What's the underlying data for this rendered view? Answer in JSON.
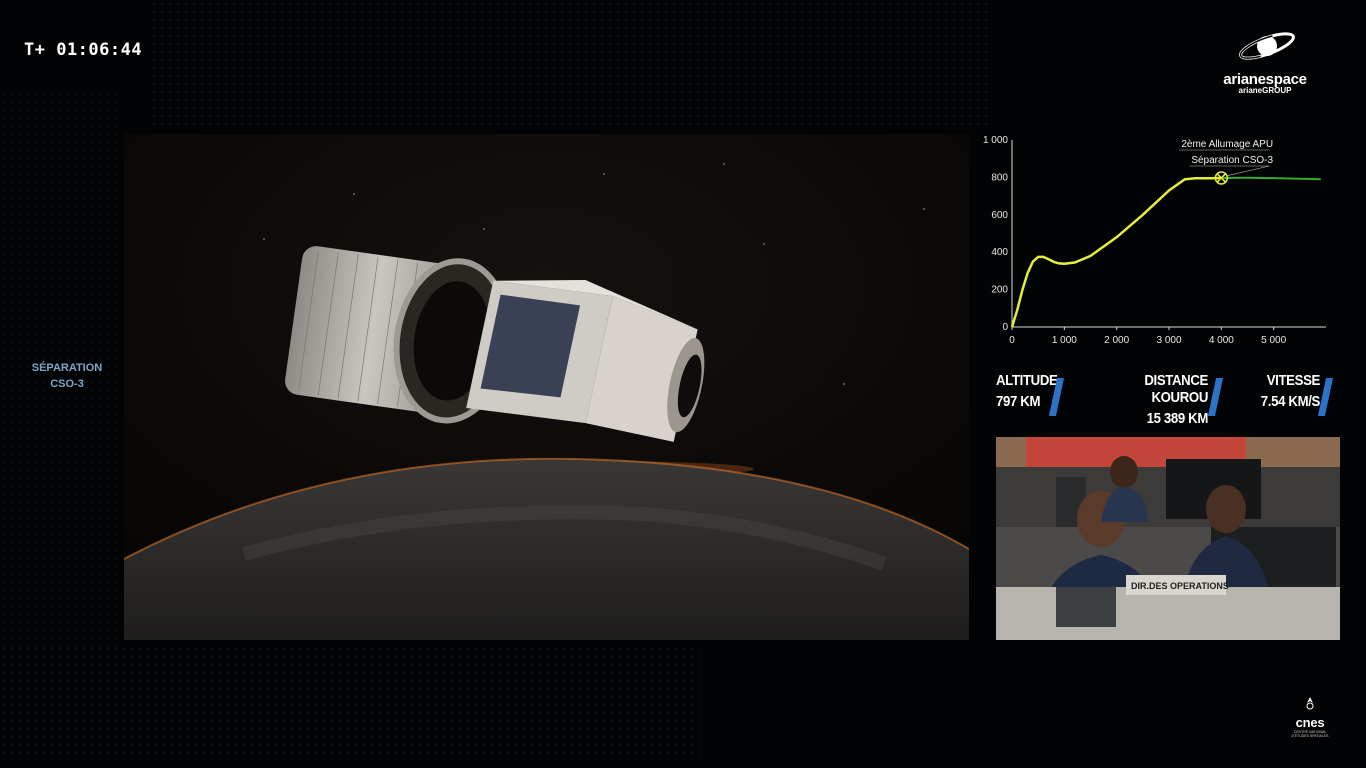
{
  "overlay": {
    "timer": "T+ 01:06:44",
    "phase_line1": "SÉPARATION",
    "phase_line2": "CSO-3"
  },
  "brand": {
    "name": "arianespace",
    "sub": "arianeGROUP",
    "cnes": "cnes",
    "cnes_sub": "CENTRE NATIONAL D'ÉTUDES SPATIALES"
  },
  "telemetry": {
    "altitude_label": "ALTITUDE",
    "altitude_value": "797 KM",
    "distance_label": "DISTANCE KOUROU",
    "distance_value": "15 389 KM",
    "speed_label": "VITESSE",
    "speed_value": "7.54 KM/S",
    "accent": "#2a73c7"
  },
  "chart_data": {
    "type": "line",
    "title": "",
    "xlabel": "",
    "ylabel": "",
    "xlim": [
      0,
      6000
    ],
    "ylim": [
      0,
      1000
    ],
    "x_ticks": [
      "0",
      "1 000",
      "2 000",
      "3 000",
      "4 000",
      "5 000"
    ],
    "x_tick_values": [
      0,
      1000,
      2000,
      3000,
      4000,
      5000
    ],
    "y_ticks": [
      "0",
      "200",
      "400",
      "600",
      "800",
      "1 000"
    ],
    "y_tick_values": [
      0,
      200,
      400,
      600,
      800,
      1000
    ],
    "series": [
      {
        "color_past": "#e5ef3a",
        "color_future": "#2fae2f",
        "x": [
          0,
          100,
          200,
          300,
          400,
          500,
          600,
          700,
          800,
          900,
          1000,
          1200,
          1500,
          2000,
          2500,
          3000,
          3300,
          3500,
          3800,
          4000,
          4500,
          5000,
          5500,
          5900
        ],
        "y": [
          0,
          90,
          200,
          290,
          350,
          375,
          375,
          362,
          348,
          340,
          338,
          345,
          380,
          480,
          600,
          730,
          790,
          795,
          795,
          797,
          798,
          796,
          793,
          790
        ]
      }
    ],
    "current_x": 4000,
    "annotations": [
      "2ème Allumage APU",
      "Séparation CSO-3"
    ],
    "marker_x": 4000,
    "marker_y": 797
  },
  "feed": {
    "desk_label": "DIR.DES OPERATIONS"
  }
}
